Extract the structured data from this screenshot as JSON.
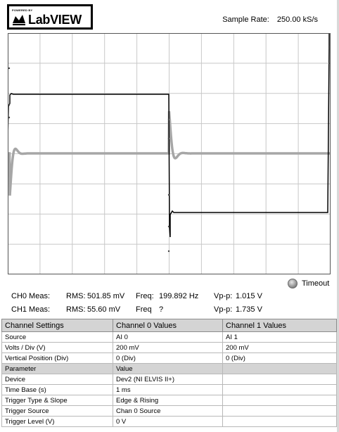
{
  "logo": {
    "powered_by": "POWERED BY",
    "brand": "LabVIEW"
  },
  "sample_rate": {
    "label": "Sample Rate:",
    "value": "250.00 kS/s"
  },
  "scope": {
    "trace_colors": {
      "ch0": "#000000",
      "ch1": "#a6a6a6"
    },
    "grid_color": "#c8c8c8"
  },
  "ch0": {
    "label": "CH0 Meas:",
    "rms_label": "RMS:",
    "rms": "501.85 mV",
    "freq_label": "Freq:",
    "freq": "199.892 Hz",
    "vpp_label": "Vp-p:",
    "vpp": "1.015 V"
  },
  "ch1": {
    "label": "CH1 Meas:",
    "rms_label": "RMS:",
    "rms": "55.60 mV",
    "freq_label": "Freq",
    "freq": "?",
    "vpp_label": "Vp-p:",
    "vpp": "1.735 V"
  },
  "timeout": {
    "label": "Timeout",
    "icon": "led-indicator"
  },
  "table": {
    "columns": [
      "Channel Settings",
      "Channel 0 Values",
      "Channel 1 Values"
    ],
    "rows": [
      [
        "Source",
        "AI 0",
        "AI 1"
      ],
      [
        "Volts / Div (V)",
        "200 mV",
        "200 mV"
      ],
      [
        "Vertical Position (Div)",
        "0 (Div)",
        "0 (Div)"
      ],
      [
        "Parameter",
        "Value",
        ""
      ],
      [
        "Device",
        "Dev2 (NI ELVIS II+)",
        ""
      ],
      [
        "Time Base (s)",
        "1 ms",
        ""
      ],
      [
        "Trigger Type & Slope",
        "Edge & Rising",
        ""
      ],
      [
        "Trigger Source",
        "Chan 0 Source",
        ""
      ],
      [
        "Trigger Level (V)",
        "0 V",
        ""
      ]
    ]
  }
}
